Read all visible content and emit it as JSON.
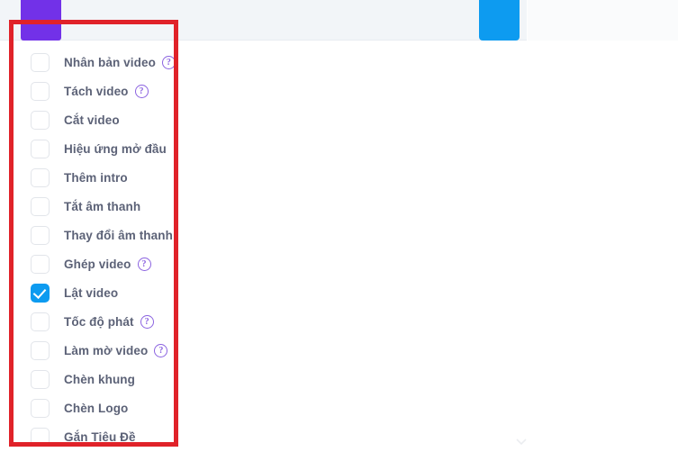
{
  "header": {
    "accent_tab_color": "#7231e8",
    "action_button_color": "#0d9bf0",
    "background_color": "#f2f5f8"
  },
  "annotation": {
    "color": "#e02229",
    "shape": "rectangle"
  },
  "scrollbar": {
    "thumb_color": "#e3e8ee"
  },
  "feature_list": {
    "help_icon_glyph": "?",
    "checked_color": "#0d9bf0",
    "items": [
      {
        "label": "Nhân bản video",
        "checked": false,
        "has_help": true
      },
      {
        "label": "Tách video",
        "checked": false,
        "has_help": true
      },
      {
        "label": "Cắt video",
        "checked": false,
        "has_help": false
      },
      {
        "label": "Hiệu ứng mở đầu",
        "checked": false,
        "has_help": false
      },
      {
        "label": "Thêm intro",
        "checked": false,
        "has_help": false
      },
      {
        "label": "Tắt âm thanh",
        "checked": false,
        "has_help": false
      },
      {
        "label": "Thay đổi âm thanh",
        "checked": false,
        "has_help": false
      },
      {
        "label": "Ghép video",
        "checked": false,
        "has_help": true
      },
      {
        "label": "Lật video",
        "checked": true,
        "has_help": false
      },
      {
        "label": "Tốc độ phát",
        "checked": false,
        "has_help": true
      },
      {
        "label": "Làm mờ video",
        "checked": false,
        "has_help": true
      },
      {
        "label": "Chèn khung",
        "checked": false,
        "has_help": false
      },
      {
        "label": "Chèn Logo",
        "checked": false,
        "has_help": false
      },
      {
        "label": "Gắn Tiêu Đề",
        "checked": false,
        "has_help": false
      }
    ]
  }
}
